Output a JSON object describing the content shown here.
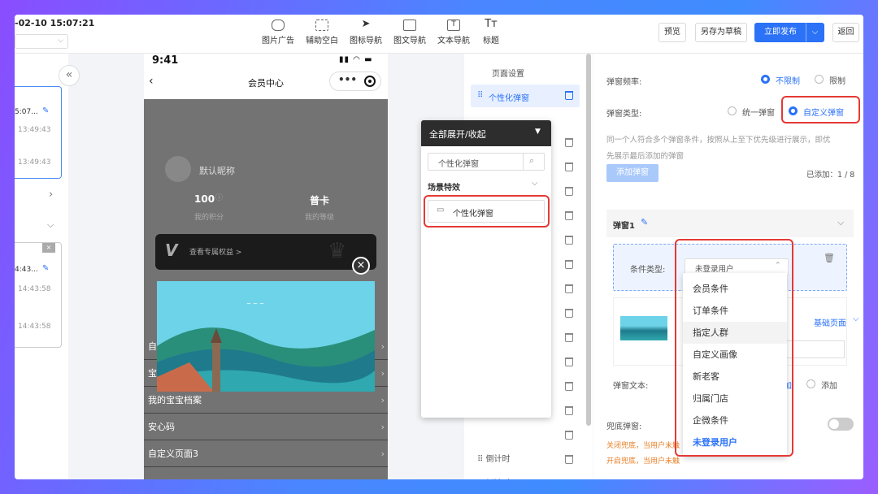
{
  "header": {
    "datetime": "-02-10 15:07:21"
  },
  "toolbar": {
    "tools": [
      "图片广告",
      "辅助空白",
      "图标导航",
      "图文导航",
      "文本导航",
      "标题"
    ],
    "preview": "预览",
    "save_draft": "另存为草稿",
    "publish": "立即发布",
    "back": "返回"
  },
  "left": {
    "cards": [
      {
        "time": "5:07...",
        "t1": "13:49:43",
        "t2": "13:49:43"
      },
      {
        "time": "4:43...",
        "t1": "14:43:58",
        "t2": "14:43:58"
      }
    ]
  },
  "phone": {
    "time": "9:41",
    "title": "会员中心",
    "nickname": "默认昵称",
    "points_value": "100",
    "points_label": "我的积分",
    "level_value": "普卡",
    "level_label": "我的等级",
    "banner_text": "查看专属权益 >",
    "menu": [
      "自",
      "宝",
      "我的宝宝档案",
      "安心码",
      "自定义页面3"
    ]
  },
  "middle": {
    "page_settings": "页面设置",
    "active_item": "个性化弹窗",
    "countdown": "倒计时"
  },
  "panel": {
    "header": "全部展开/收起",
    "search_value": "个性化弹窗",
    "section": "场景特效",
    "item": "个性化弹窗"
  },
  "settings": {
    "freq_label": "弹窗频率:",
    "freq_opt1": "不限制",
    "freq_opt2": "限制",
    "type_label": "弹窗类型:",
    "type_opt1": "统一弹窗",
    "type_opt2": "自定义弹窗",
    "desc_line1": "同一个人符合多个弹窗条件，按照从上至下优先级进行展示，即优",
    "desc_line2": "先展示最后添加的弹窗",
    "add_btn": "添加弹窗",
    "added": "已添加：1 / 8",
    "popup_title": "弹窗1",
    "cond_label": "条件类型:",
    "cond_value": "未登录用户",
    "base_page": "基础页面",
    "link_short": "链",
    "popup_text_label": "弹窗文本:",
    "add_label": "添加",
    "text_partial": "加",
    "fallback_label": "兜底弹窗:",
    "note_off": "关闭兜底，当用户未触",
    "note_on": "开启兜底，当用户未触",
    "options": [
      "会员条件",
      "订单条件",
      "指定人群",
      "自定义画像",
      "新老客",
      "归属门店",
      "企微条件",
      "未登录用户"
    ]
  },
  "colors": {
    "accent": "#2b72f7",
    "highlight": "#e53935"
  }
}
